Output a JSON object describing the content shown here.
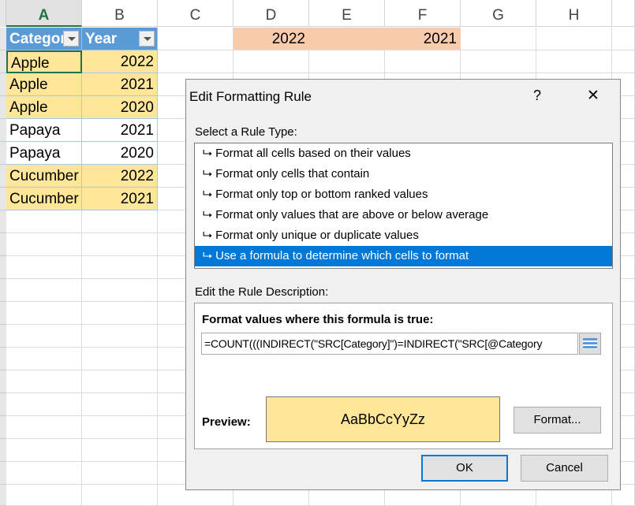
{
  "columns": [
    "A",
    "B",
    "C",
    "D",
    "E",
    "F",
    "G",
    "H"
  ],
  "table": {
    "headers": [
      "Category",
      "Year"
    ],
    "rows": [
      [
        "Apple",
        "2022",
        true
      ],
      [
        "Apple",
        "2021",
        true
      ],
      [
        "Apple",
        "2020",
        true
      ],
      [
        "Papaya",
        "2021",
        false
      ],
      [
        "Papaya",
        "2020",
        false
      ],
      [
        "Cucumber",
        "2022",
        true
      ],
      [
        "Cucumber",
        "2021",
        true
      ]
    ]
  },
  "d1": "2022",
  "f1": "2021",
  "dialog": {
    "title": "Edit Formatting Rule",
    "help": "?",
    "close": "✕",
    "select_label": "Select a Rule Type:",
    "rule_types": [
      "Format all cells based on their values",
      "Format only cells that contain",
      "Format only top or bottom ranked values",
      "Format only values that are above or below average",
      "Format only unique or duplicate values",
      "Use a formula to determine which cells to format"
    ],
    "selected_index": 5,
    "desc_label": "Edit the Rule Description:",
    "formula_label": "Format values where this formula is true:",
    "formula": "=COUNT(((INDIRECT(\"SRC[Category]\")=INDIRECT(\"SRC[@Category",
    "preview_label": "Preview:",
    "preview_text": "AaBbCcYyZz",
    "format_button": "Format...",
    "ok": "OK",
    "cancel": "Cancel"
  },
  "colors": {
    "highlight": "#ffe699",
    "header": "#5b9bd5",
    "peach": "#f8cbad",
    "selection": "#0078d7"
  }
}
